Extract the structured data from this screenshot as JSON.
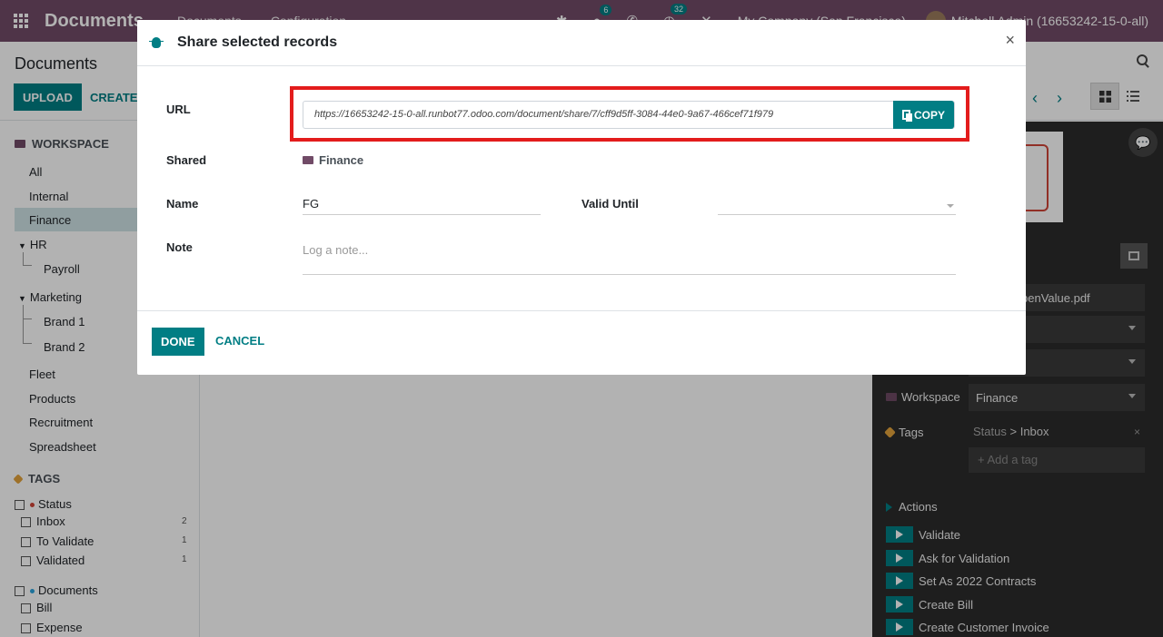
{
  "navbar": {
    "brand": "Documents",
    "menus": [
      "Documents",
      "Configuration"
    ],
    "chat_badge": "6",
    "activity_badge": "32",
    "company": "My Company (San Francisco)",
    "user": "Mitchell Admin (16653242-15-0-all)"
  },
  "control_panel": {
    "breadcrumb": "Documents",
    "upload": "UPLOAD",
    "create": "CREATE S"
  },
  "sidebar": {
    "workspace_head": "WORKSPACE",
    "items": [
      "All",
      "Internal",
      "Finance",
      "HR",
      "Payroll",
      "Marketing",
      "Brand 1",
      "Brand 2",
      "Fleet",
      "Products",
      "Recruitment",
      "Spreadsheet"
    ],
    "tags_head": "TAGS",
    "tag_groups": [
      {
        "name": "Status",
        "color": "#d04437",
        "tags": [
          {
            "label": "Inbox",
            "count": "2"
          },
          {
            "label": "To Validate",
            "count": "1"
          },
          {
            "label": "Validated",
            "count": "1"
          }
        ]
      },
      {
        "name": "Documents",
        "color": "#2aa4dd",
        "tags": [
          {
            "label": "Bill"
          },
          {
            "label": "Expense"
          }
        ]
      }
    ]
  },
  "inspector": {
    "name_partial": "penValue.pdf",
    "workspace_label": "Workspace",
    "workspace_value": "Finance",
    "tags_label": "Tags",
    "tag_group": "Status",
    "tag_sep": ">",
    "tag_value": "Inbox",
    "add_tag_placeholder": "+ Add a tag",
    "actions_label": "Actions",
    "actions": [
      "Validate",
      "Ask for Validation",
      "Set As 2022 Contracts",
      "Create Bill",
      "Create Customer Invoice"
    ]
  },
  "modal": {
    "title": "Share selected records",
    "close": "×",
    "url_label": "URL",
    "url_value": "https://16653242-15-0-all.runbot77.odoo.com/document/share/7/cff9d5ff-3084-44e0-9a67-466cef71f979",
    "copy_label": "COPY",
    "shared_label": "Shared",
    "shared_value": "Finance",
    "name_label": "Name",
    "name_value": "FG",
    "valid_until_label": "Valid Until",
    "valid_until_value": "",
    "note_label": "Note",
    "note_placeholder": "Log a note...",
    "done": "DONE",
    "cancel": "CANCEL"
  },
  "colors": {
    "brand": "#714b67",
    "accent": "#017e84",
    "highlight": "#e31c1c"
  }
}
